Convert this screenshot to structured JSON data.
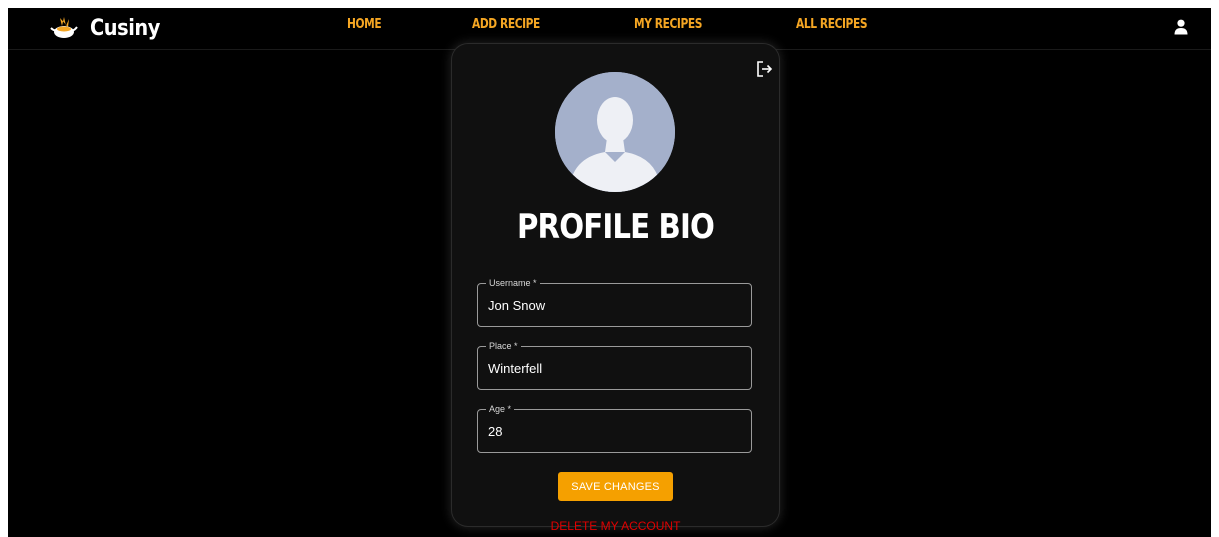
{
  "app": {
    "brand_name": "Cusiny",
    "logo_icon": "chef-pot-icon"
  },
  "nav": {
    "home": "HOME",
    "add_recipe": "ADD RECIPE",
    "my_recipes": "MY RECIPES",
    "all_recipes": "ALL RECIPES",
    "user_icon": "user-icon"
  },
  "colors": {
    "accent": "#f5a623",
    "background": "#000000",
    "card": "#101010",
    "danger": "#e00000",
    "avatar_bg": "#a4b0cb"
  },
  "profile": {
    "title": "PROFILE BIO",
    "logout_icon": "logout-icon",
    "avatar_icon": "avatar-silhouette-icon",
    "fields": {
      "username": {
        "label": "Username *",
        "value": "Jon Snow"
      },
      "place": {
        "label": "Place *",
        "value": "Winterfell"
      },
      "age": {
        "label": "Age *",
        "value": "28"
      }
    },
    "save_label": "SAVE CHANGES",
    "delete_label": "DELETE MY ACCOUNT"
  }
}
